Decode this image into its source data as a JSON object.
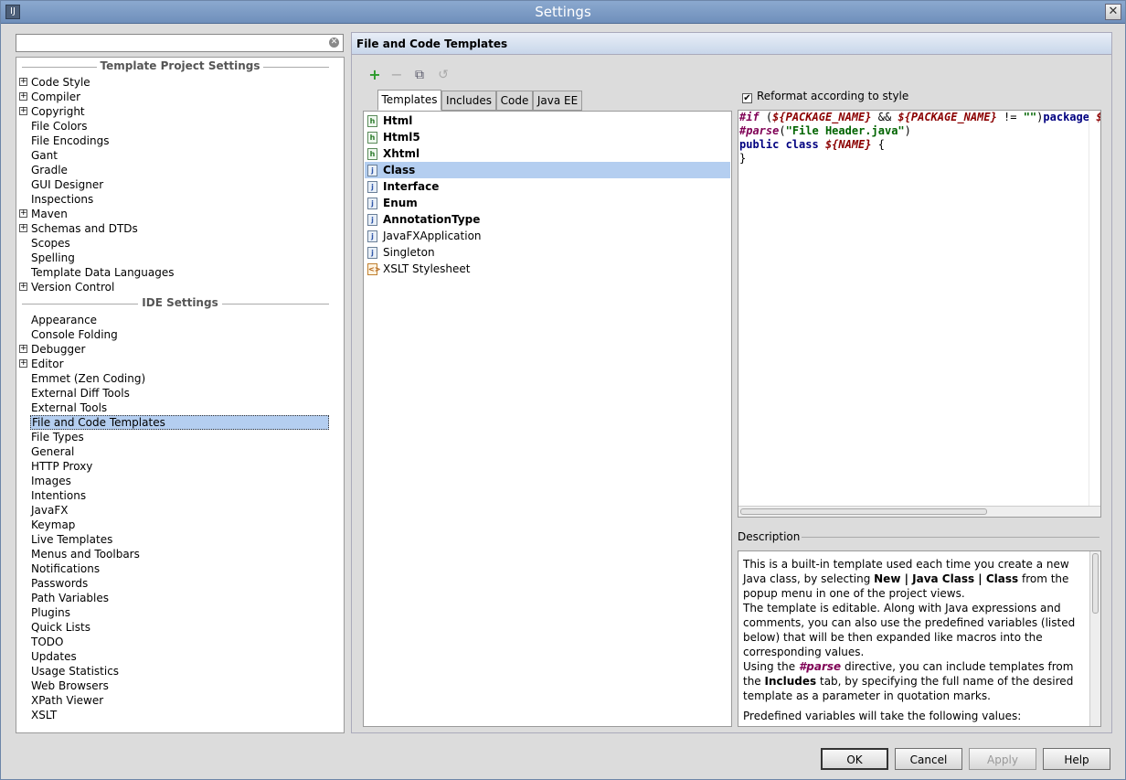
{
  "window": {
    "title": "Settings",
    "app_icon": "IJ"
  },
  "search": {
    "value": "",
    "placeholder": ""
  },
  "tree": {
    "project_header": "Template Project Settings",
    "project_items": [
      {
        "label": "Code Style",
        "expandable": true
      },
      {
        "label": "Compiler",
        "expandable": true
      },
      {
        "label": "Copyright",
        "expandable": true
      },
      {
        "label": "File Colors",
        "expandable": false
      },
      {
        "label": "File Encodings",
        "expandable": false
      },
      {
        "label": "Gant",
        "expandable": false
      },
      {
        "label": "Gradle",
        "expandable": false
      },
      {
        "label": "GUI Designer",
        "expandable": false
      },
      {
        "label": "Inspections",
        "expandable": false
      },
      {
        "label": "Maven",
        "expandable": true
      },
      {
        "label": "Schemas and DTDs",
        "expandable": true
      },
      {
        "label": "Scopes",
        "expandable": false
      },
      {
        "label": "Spelling",
        "expandable": false
      },
      {
        "label": "Template Data Languages",
        "expandable": false
      },
      {
        "label": "Version Control",
        "expandable": true
      }
    ],
    "ide_header": "IDE Settings",
    "ide_items": [
      {
        "label": "Appearance",
        "expandable": false
      },
      {
        "label": "Console Folding",
        "expandable": false
      },
      {
        "label": "Debugger",
        "expandable": true
      },
      {
        "label": "Editor",
        "expandable": true
      },
      {
        "label": "Emmet (Zen Coding)",
        "expandable": false
      },
      {
        "label": "External Diff Tools",
        "expandable": false
      },
      {
        "label": "External Tools",
        "expandable": false
      },
      {
        "label": "File and Code Templates",
        "expandable": false,
        "selected": true
      },
      {
        "label": "File Types",
        "expandable": false
      },
      {
        "label": "General",
        "expandable": false
      },
      {
        "label": "HTTP Proxy",
        "expandable": false
      },
      {
        "label": "Images",
        "expandable": false
      },
      {
        "label": "Intentions",
        "expandable": false
      },
      {
        "label": "JavaFX",
        "expandable": false
      },
      {
        "label": "Keymap",
        "expandable": false
      },
      {
        "label": "Live Templates",
        "expandable": false
      },
      {
        "label": "Menus and Toolbars",
        "expandable": false
      },
      {
        "label": "Notifications",
        "expandable": false
      },
      {
        "label": "Passwords",
        "expandable": false
      },
      {
        "label": "Path Variables",
        "expandable": false
      },
      {
        "label": "Plugins",
        "expandable": false
      },
      {
        "label": "Quick Lists",
        "expandable": false
      },
      {
        "label": "TODO",
        "expandable": false
      },
      {
        "label": "Updates",
        "expandable": false
      },
      {
        "label": "Usage Statistics",
        "expandable": false
      },
      {
        "label": "Web Browsers",
        "expandable": false
      },
      {
        "label": "XPath Viewer",
        "expandable": false
      },
      {
        "label": "XSLT",
        "expandable": false
      }
    ]
  },
  "panel": {
    "title": "File and Code Templates",
    "toolbar": {
      "add_icon": "+",
      "remove_icon": "−",
      "copy_icon": "⧉",
      "reset_icon": "↺"
    },
    "tabs": [
      "Templates",
      "Includes",
      "Code",
      "Java EE"
    ],
    "active_tab": "Templates",
    "templates": [
      {
        "label": "Html",
        "bold": true,
        "icon": "html-file-icon",
        "glyph": "h"
      },
      {
        "label": "Html5",
        "bold": true,
        "icon": "html-file-icon",
        "glyph": "h"
      },
      {
        "label": "Xhtml",
        "bold": true,
        "icon": "xhtml-file-icon",
        "glyph": "h"
      },
      {
        "label": "Class",
        "bold": true,
        "icon": "java-class-file-icon",
        "glyph": "j",
        "selected": true
      },
      {
        "label": "Interface",
        "bold": true,
        "icon": "java-interface-file-icon",
        "glyph": "j"
      },
      {
        "label": "Enum",
        "bold": true,
        "icon": "java-enum-file-icon",
        "glyph": "j"
      },
      {
        "label": "AnnotationType",
        "bold": true,
        "icon": "java-annotation-file-icon",
        "glyph": "j"
      },
      {
        "label": "JavaFXApplication",
        "bold": false,
        "icon": "java-file-icon",
        "glyph": "j"
      },
      {
        "label": "Singleton",
        "bold": false,
        "icon": "java-file-icon",
        "glyph": "j"
      },
      {
        "label": "XSLT Stylesheet",
        "bold": false,
        "icon": "xslt-file-icon",
        "glyph": "<>"
      }
    ],
    "reformat_label": "Reformat according to style",
    "reformat_checked": true,
    "editor": {
      "line1": {
        "dir": "#if",
        "p1": " (",
        "var1": "${PACKAGE_NAME}",
        "p2": " && ",
        "var2": "${PACKAGE_NAME}",
        "p3": " != ",
        "str": "\"\"",
        "p4": ")",
        "kw": "package",
        "tail": " $"
      },
      "line2": {
        "dir": "#parse",
        "p1": "(",
        "str": "\"File Header.java\"",
        "p2": ")"
      },
      "line3": {
        "kw": "public class",
        "p1": " ",
        "var": "${NAME}",
        "p2": " {"
      },
      "line4": "}"
    },
    "description_label": "Description",
    "description": {
      "p1a": "This is a built-in template used each time you create a new Java class, by selecting ",
      "p1b": "New | Java Class | Class",
      "p1c": " from the popup menu in one of the project views.",
      "p2": "The template is editable. Along with Java expressions and comments, you can also use the predefined variables (listed below) that will be then expanded like macros into the corresponding values.",
      "p3a": "Using the ",
      "p3b": "#parse",
      "p3c": " directive, you can include templates from the ",
      "p3d": "Includes",
      "p3e": " tab, by specifying the full name of the desired template as a parameter in quotation marks.",
      "p4": "Predefined variables will take the following values:"
    }
  },
  "buttons": {
    "ok": "OK",
    "cancel": "Cancel",
    "apply": "Apply",
    "help": "Help"
  },
  "colors": {
    "selection": "#b4cef0",
    "title_bar": "#7c9cc6"
  }
}
